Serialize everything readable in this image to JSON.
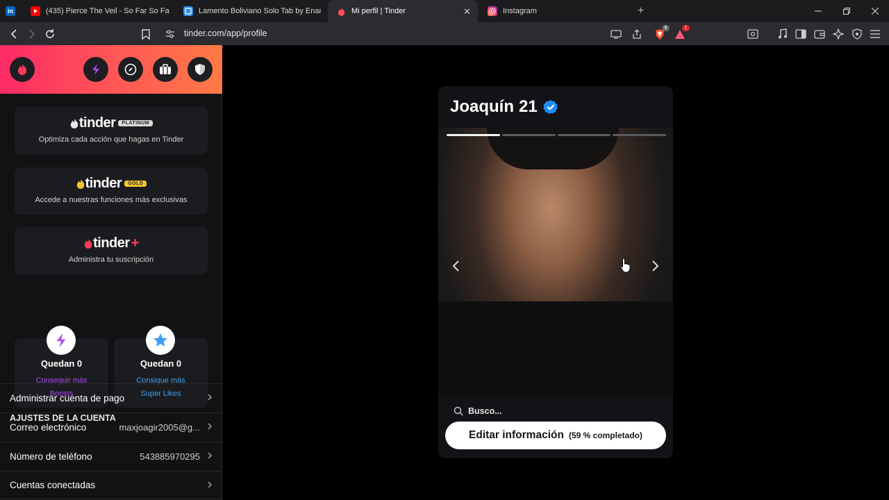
{
  "browser": {
    "tabs": [
      {
        "title": "(435) Pierce The Veil - So Far So Fake",
        "favicon": "youtube-icon"
      },
      {
        "title": "Lamento Boliviano Solo Tab by Enani",
        "favicon": "songsterr-icon"
      },
      {
        "title": "Mi perfil | Tinder",
        "favicon": "tinder-icon"
      },
      {
        "title": "Instagram",
        "favicon": "instagram-icon"
      }
    ],
    "url": "tinder.com/app/profile",
    "brave_shield_count": "8",
    "rewards_count": "1"
  },
  "sidebar": {
    "header_buttons": [
      "tinder-flame-icon",
      "boost-icon",
      "explore-icon",
      "briefcase-icon",
      "shield-icon"
    ],
    "promos": [
      {
        "logo": "tinder",
        "tier": "PLATINUM",
        "desc": "Optimiza cada acción que hagas en Tinder"
      },
      {
        "logo": "tinder",
        "tier": "GOLD",
        "desc": "Accede a nuestras funciones más exclusivas"
      },
      {
        "logo": "tinder",
        "tier": "+",
        "desc": "Administra tu suscripción"
      }
    ],
    "boosts": {
      "count": "Quedan 0",
      "link_line1": "Conseguir más",
      "link_line2": "Boosts"
    },
    "superlikes": {
      "count": "Quedan 0",
      "link_line1": "Consigue más",
      "link_line2": "Super Likes"
    },
    "settings_title": "AJUSTES DE LA CUENTA",
    "settings": [
      {
        "label": "Administrar cuenta de pago",
        "value": ""
      },
      {
        "label": "Correo electrónico",
        "value": "maxjoagir2005@g..."
      },
      {
        "label": "Número de teléfono",
        "value": "543885970295"
      },
      {
        "label": "Cuentas conectadas",
        "value": ""
      }
    ]
  },
  "profile": {
    "name": "Joaquín",
    "age": "21",
    "photo_count": 4,
    "current_photo": 1,
    "search_label": "Busco...",
    "edit_button": "Editar información",
    "completion": "(59 % completado)"
  },
  "colors": {
    "brand_gradient_start": "#fd2a65",
    "brand_gradient_end": "#ff7a45",
    "boost_purple": "#a94cf0",
    "superlike_blue": "#3da0f5",
    "verified_blue": "#1c8ef9"
  }
}
